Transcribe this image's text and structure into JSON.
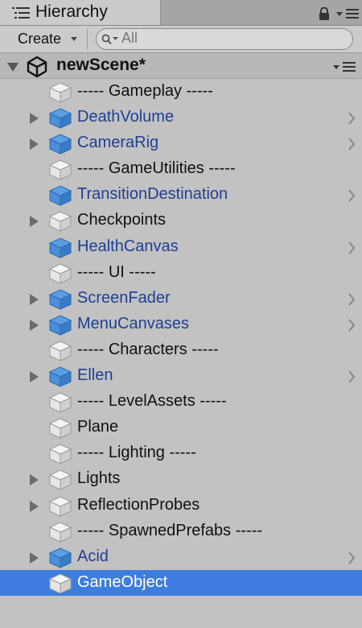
{
  "window": {
    "tab_label": "Hierarchy",
    "tab_icon": "list-icon",
    "lock_icon": "lock-icon",
    "menu_icon": "panel-menu-icon"
  },
  "toolbar": {
    "create_label": "Create",
    "search_placeholder": "All"
  },
  "scene": {
    "name": "newScene*",
    "icon": "unity-logo-icon",
    "expanded": true
  },
  "items": [
    {
      "label": "----- Gameplay -----",
      "has_children": false,
      "prefab": false,
      "selected": false
    },
    {
      "label": "DeathVolume",
      "has_children": true,
      "prefab": true,
      "selected": false
    },
    {
      "label": "CameraRig",
      "has_children": true,
      "prefab": true,
      "selected": false
    },
    {
      "label": "----- GameUtilities -----",
      "has_children": false,
      "prefab": false,
      "selected": false
    },
    {
      "label": "TransitionDestination",
      "has_children": false,
      "prefab": true,
      "selected": false
    },
    {
      "label": "Checkpoints",
      "has_children": true,
      "prefab": false,
      "selected": false
    },
    {
      "label": "HealthCanvas",
      "has_children": false,
      "prefab": true,
      "selected": false
    },
    {
      "label": "----- UI -----",
      "has_children": false,
      "prefab": false,
      "selected": false
    },
    {
      "label": "ScreenFader",
      "has_children": true,
      "prefab": true,
      "selected": false
    },
    {
      "label": "MenuCanvases",
      "has_children": true,
      "prefab": true,
      "selected": false
    },
    {
      "label": "----- Characters -----",
      "has_children": false,
      "prefab": false,
      "selected": false
    },
    {
      "label": "Ellen",
      "has_children": true,
      "prefab": true,
      "selected": false
    },
    {
      "label": "----- LevelAssets -----",
      "has_children": false,
      "prefab": false,
      "selected": false
    },
    {
      "label": "Plane",
      "has_children": false,
      "prefab": false,
      "selected": false
    },
    {
      "label": "----- Lighting -----",
      "has_children": false,
      "prefab": false,
      "selected": false
    },
    {
      "label": "Lights",
      "has_children": true,
      "prefab": false,
      "selected": false
    },
    {
      "label": "ReflectionProbes",
      "has_children": true,
      "prefab": false,
      "selected": false
    },
    {
      "label": "----- SpawnedPrefabs -----",
      "has_children": false,
      "prefab": false,
      "selected": false
    },
    {
      "label": "Acid",
      "has_children": true,
      "prefab": true,
      "selected": false
    },
    {
      "label": "GameObject",
      "has_children": false,
      "prefab": false,
      "selected": true
    }
  ],
  "colors": {
    "panel_bg": "#c2c2c2",
    "prefab_text": "#1f3f94",
    "selection": "#3e7ddf",
    "cube_gray": "#e6e6e6",
    "cube_blue": "#4b8fd8"
  }
}
